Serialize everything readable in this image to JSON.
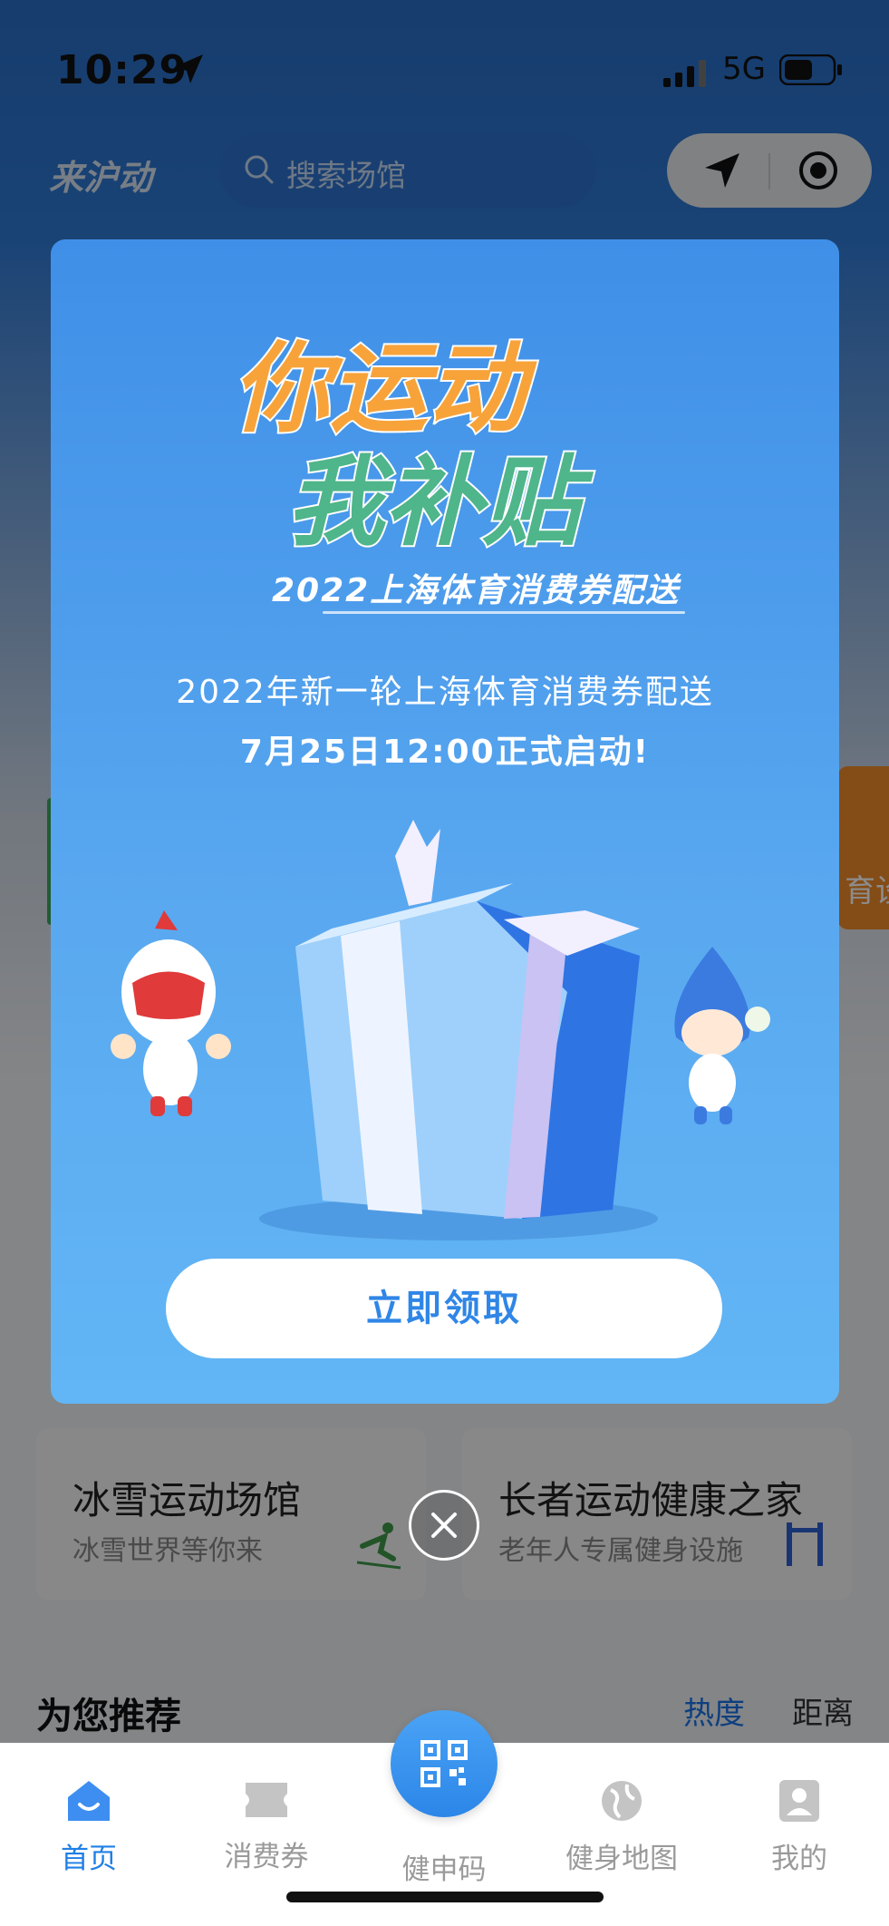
{
  "status_bar": {
    "time": "10:29",
    "network": "5G"
  },
  "header": {
    "brand": "来沪动",
    "search_placeholder": "搜索场馆"
  },
  "background": {
    "banner_text": "育设",
    "cards": [
      {
        "title": "冰雪运动场馆",
        "subtitle": "冰雪世界等你来"
      },
      {
        "title": "长者运动健康之家",
        "subtitle": "老年人专属健身设施"
      }
    ],
    "recommend": {
      "title": "为您推荐",
      "sort_hot": "热度",
      "sort_distance": "距离"
    }
  },
  "popup": {
    "hero_line1": "你运动",
    "hero_line2": "我补贴",
    "hero_subtitle": "2022上海体育消费券配送",
    "desc_line1": "2022年新一轮上海体育消费券配送",
    "desc_line2": "7月25日12:00正式启动!",
    "claim_button": "立即领取"
  },
  "tabbar": {
    "items": [
      {
        "label": "首页",
        "icon": "home-icon",
        "active": true
      },
      {
        "label": "消费券",
        "icon": "ticket-icon",
        "active": false
      },
      {
        "label": "健申码",
        "icon": "qr-code-icon",
        "active": false
      },
      {
        "label": "健身地图",
        "icon": "globe-icon",
        "active": false
      },
      {
        "label": "我的",
        "icon": "profile-icon",
        "active": false
      }
    ]
  },
  "colors": {
    "accent": "#1f7fe6",
    "popup_top": "#3f8fe8",
    "popup_bottom": "#62b6f5"
  }
}
